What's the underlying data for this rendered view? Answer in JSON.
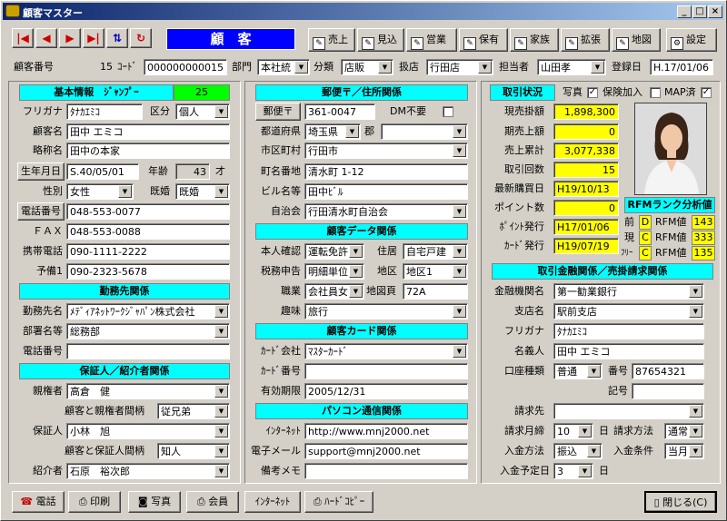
{
  "window": {
    "title": "顧客マスター"
  },
  "toolbar": {
    "title_label": "顧　客",
    "buttons": [
      "売上",
      "見込",
      "営業",
      "保有",
      "家族",
      "拡張",
      "地図"
    ],
    "settings_label": "設定"
  },
  "topbar": {
    "customer_no_label": "顧客番号",
    "customer_no": "15",
    "code_label": "ｺｰﾄﾞ",
    "code": "000000000015",
    "dept_label": "部門",
    "dept": "本社統",
    "category_label": "分類",
    "category": "店販",
    "store_label": "扱店",
    "store": "行田店",
    "staff_label": "担当者",
    "staff": "山田孝",
    "reg_date_label": "登録日",
    "reg_date": "H.17/01/06"
  },
  "basic": {
    "header": "基本情報　ｼﾞｬﾝﾌﾟｰ",
    "jump_value": "25",
    "furigana_label": "フリガナ",
    "furigana": "ﾀﾅｶｴﾐｺ",
    "kubun_label": "区分",
    "kubun": "個人",
    "name_label": "顧客名",
    "name": "田中 エミコ",
    "short_label": "略称名",
    "short": "田中の本家",
    "birth_label": "生年月日",
    "birth": "S.40/05/01",
    "age_label": "年齢",
    "age": "43",
    "age_unit": "才",
    "sex_label": "性別",
    "sex": "女性",
    "married_label": "既婚",
    "married": "既婚",
    "phone_label": "電話番号",
    "phone": "048-553-0077",
    "fax_label": "ＦＡＸ",
    "fax": "048-553-0088",
    "mobile_label": "携帯電話",
    "mobile": "090-1111-2222",
    "spare_label": "予備1",
    "spare": "090-2323-5678"
  },
  "work": {
    "header": "勤務先関係",
    "company_label": "勤務先名",
    "company": "ﾒﾃﾞｨｱﾈｯﾄﾜｰｸｼﾞｬﾊﾟﾝ株式会社",
    "section_label": "部署名等",
    "section": "総務部",
    "phone_label": "電話番号",
    "phone": ""
  },
  "guarantor": {
    "header": "保証人／紹介者関係",
    "parent_label": "親権者",
    "parent": "高倉　健",
    "parent_rel_label": "顧客と親権者間柄",
    "parent_rel": "従兄弟",
    "guarantor_label": "保証人",
    "guarantor": "小林　旭",
    "guarantor_rel_label": "顧客と保証人間柄",
    "guarantor_rel": "知人",
    "introducer_label": "紹介者",
    "introducer": "石原　裕次郎"
  },
  "address": {
    "header": "郵便〒／住所関係",
    "zip_button": "郵便〒",
    "zip": "361-0047",
    "dm_label": "DM不要",
    "pref_label": "都道府県",
    "pref": "埼玉県",
    "gun_label": "郡",
    "gun": "",
    "city_label": "市区町村",
    "city": "行田市",
    "street_label": "町名番地",
    "street": "清水町 1-12",
    "building_label": "ビル名等",
    "building": "田中ﾋﾞﾙ",
    "assoc_label": "自治会",
    "assoc": "行田清水町自治会"
  },
  "custdata": {
    "header": "顧客データ関係",
    "id_label": "本人確認",
    "id": "運転免許",
    "house_label": "住居",
    "house": "自宅戸建",
    "tax_label": "税務申告",
    "tax": "明細単位",
    "area_label": "地区",
    "area": "地区1",
    "job_label": "職業",
    "job": "会社員女",
    "map_label": "地図頁",
    "map": "72A",
    "hobby_label": "趣味",
    "hobby": "旅行"
  },
  "card": {
    "header": "顧客カード関係",
    "company_label": "ｶｰﾄﾞ会社",
    "company": "ﾏｽﾀｰｶｰﾄﾞ",
    "number_label": "ｶｰﾄﾞ番号",
    "number": "",
    "expiry_label": "有効期限",
    "expiry": "2005/12/31"
  },
  "pc": {
    "header": "パソコン通信関係",
    "web_label": "ｲﾝﾀｰﾈｯﾄ",
    "web": "http://www.mnj2000.net",
    "mail_label": "電子メール",
    "mail": "support@mnj2000.net",
    "memo_label": "備考メモ",
    "memo": ""
  },
  "trade": {
    "header": "取引状況",
    "photo_label": "写真",
    "insurance_label": "保険加入",
    "map_label": "MAP済",
    "balance_label": "現売掛額",
    "balance": "1,898,300",
    "prev_label": "期売上額",
    "prev": "0",
    "total_label": "売上累計",
    "total": "3,077,338",
    "count_label": "取引回数",
    "count": "15",
    "last_label": "最新購買日",
    "last": "H19/10/13",
    "points_label": "ポイント数",
    "points": "0",
    "point_issue_label": "ﾎﾟｲﾝﾄ発行",
    "point_issue": "H17/01/06",
    "card_issue_label": "ｶｰﾄﾞ発行",
    "card_issue": "H19/07/19"
  },
  "rfm": {
    "header": "RFMランク分析値",
    "rows": [
      {
        "label": "前",
        "rank": "D",
        "value_label": "RFM値",
        "value": "143"
      },
      {
        "label": "現",
        "rank": "C",
        "value_label": "RFM値",
        "value": "333"
      },
      {
        "label": "ﾌﾘｰ",
        "rank": "C",
        "value_label": "RFM値",
        "value": "135"
      }
    ]
  },
  "bank": {
    "header": "取引金融関係／売掛請求関係",
    "bank_label": "金融機関名",
    "bank": "第一勧業銀行",
    "branch_label": "支店名",
    "branch": "駅前支店",
    "furigana_label": "フリガナ",
    "furigana": "ﾀﾅｶｴﾐｺ",
    "holder_label": "名義人",
    "holder": "田中 エミコ",
    "type_label": "口座種類",
    "type": "普通",
    "acct_label": "番号",
    "acct": "87654321",
    "sign_label": "記号",
    "sign": "",
    "billto_label": "請求先",
    "billto": "",
    "close_label": "請求月締",
    "close": "10",
    "day_unit": "日",
    "method_label": "請求方法",
    "method": "通常",
    "paymethod_label": "入金方法",
    "paymethod": "振込",
    "cond_label": "入金条件",
    "cond": "当月",
    "due_label": "入金予定日",
    "due": "3"
  },
  "bottom": {
    "phone": "電話",
    "print": "印刷",
    "photo": "写真",
    "member": "会員",
    "internet": "ｲﾝﾀｰﾈｯﾄ",
    "hardcopy": "ﾊｰﾄﾞｺﾋﾟｰ",
    "close": "閉じる(C)"
  },
  "colors": {
    "header_bg": "#00ffff",
    "highlight": "#ffff00",
    "jump": "#00ff00",
    "title_blue": "#0000ff"
  }
}
